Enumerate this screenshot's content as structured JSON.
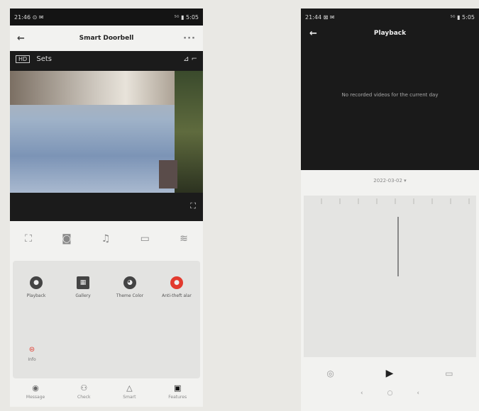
{
  "left_phone": {
    "statusbar": {
      "left": "21:46 ⊙ ✉",
      "right": "⁵ᴳ ▮ 5:05"
    },
    "appbar": {
      "title": "Smart Doorbell",
      "more": "···"
    },
    "video": {
      "hd": "HD",
      "quality": "Sets",
      "icons_right": "⊿  ⌐"
    },
    "controls": [
      "⛶",
      "◙",
      "♫",
      "▭",
      "≋"
    ],
    "features": [
      {
        "label": "Playback",
        "icon": "playback-icon",
        "color": "#444444"
      },
      {
        "label": "Gallery",
        "icon": "gallery-icon",
        "color": "#444444"
      },
      {
        "label": "Theme Color",
        "icon": "palette-icon",
        "color": "#444444"
      },
      {
        "label": "Anti-theft alar",
        "icon": "alarm-icon",
        "color": "#e23a2e"
      }
    ],
    "feature_extra": {
      "label": "Info",
      "icon": "info-icon",
      "color": "#e23a2e"
    },
    "tabs": [
      {
        "label": "Message",
        "glyph": "◉"
      },
      {
        "label": "Check",
        "glyph": "⚇"
      },
      {
        "label": "Smart",
        "glyph": "△"
      },
      {
        "label": "Features",
        "glyph": "▣",
        "active": true
      }
    ]
  },
  "right_phone": {
    "statusbar": {
      "left": "21:44 ⊠ ✉",
      "right": "⁵ᴳ ▮ 5:05"
    },
    "title": "Playback",
    "message": "No recorded videos for the current day",
    "date": "2022-03-02 ▾",
    "controls": {
      "left": "◎",
      "play": "▶",
      "right": "▭"
    },
    "nav": [
      "‹",
      "○",
      "‹"
    ]
  },
  "colors": {
    "accent_red": "#e23a2e",
    "dark_bg": "#1a1a1a"
  }
}
